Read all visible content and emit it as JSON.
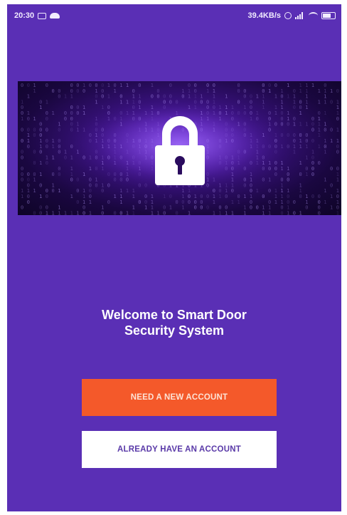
{
  "status_bar": {
    "time": "20:30",
    "network_speed": "39.4KB/s",
    "icons": [
      "message-icon",
      "cloud-icon",
      "alarm-icon",
      "signal-icon",
      "wifi-icon",
      "battery-icon"
    ]
  },
  "banner": {
    "icon": "lock-icon",
    "background": "#1a0740",
    "glow": "#8b5cf6"
  },
  "welcome": {
    "line1": "Welcome to Smart Door",
    "line2": "Security System"
  },
  "actions": {
    "new_account_label": "NEED A NEW ACCOUNT",
    "existing_account_label": "ALREADY HAVE AN ACCOUNT"
  },
  "colors": {
    "background": "#5a2fb5",
    "primary_button": "#f4592a",
    "secondary_button": "#ffffff"
  }
}
